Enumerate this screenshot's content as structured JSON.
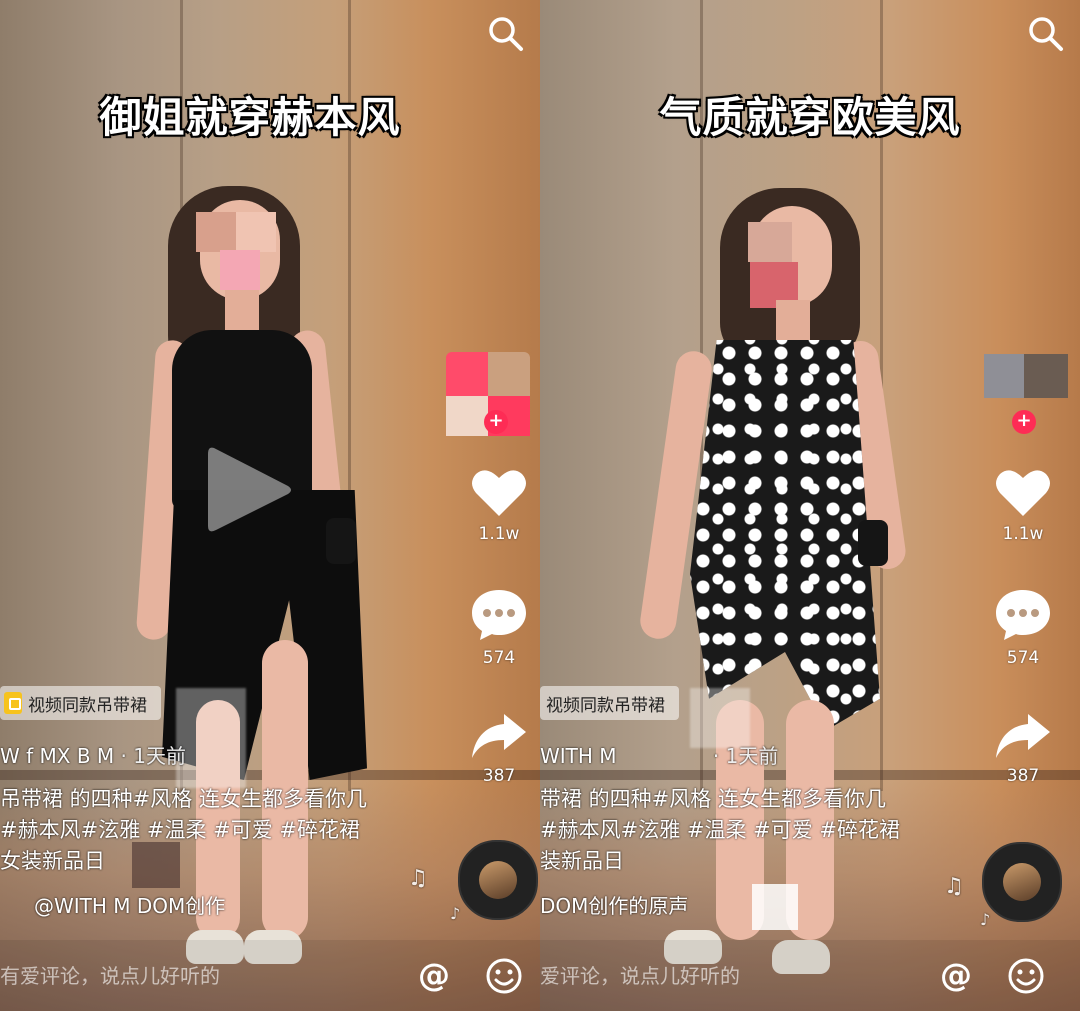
{
  "panels": [
    {
      "title": "御姐就穿赫本风",
      "product": "视频同款吊带裙",
      "author": "W     f MX B    M",
      "time": "· 1天前",
      "caption_lines": [
        "吊带裙 的四种#风格 连女生都多看你几",
        "#赫本风#泫雅 #温柔 #可爱 #碎花裙",
        "女装新品日"
      ],
      "sound": "@WITH M     DOM创作",
      "likes": "1.1w",
      "comments": "574",
      "shares": "387",
      "comment_placeholder": "有爱评论，说点儿好听的",
      "at_symbol": "@"
    },
    {
      "title": "气质就穿欧美风",
      "product": "视频同款吊带裙",
      "author": "WITH M",
      "time": "  · 1天前",
      "caption_lines": [
        "带裙 的四种#风格 连女生都多看你几",
        "#赫本风#泫雅 #温柔 #可爱 #碎花裙",
        "装新品日"
      ],
      "sound": "DOM创作的原声",
      "likes": "1.1w",
      "comments": "574",
      "shares": "387",
      "comment_placeholder": "爱评论，说点儿好听的",
      "at_symbol": "@"
    }
  ],
  "colors": {
    "accent": "#fe2c55",
    "product_tag": "#f7c31d"
  },
  "icons": [
    "search-icon",
    "play-icon",
    "heart-icon",
    "comment-icon",
    "share-icon",
    "at-icon",
    "emoji-icon",
    "music-disc-icon",
    "music-note-icon"
  ]
}
